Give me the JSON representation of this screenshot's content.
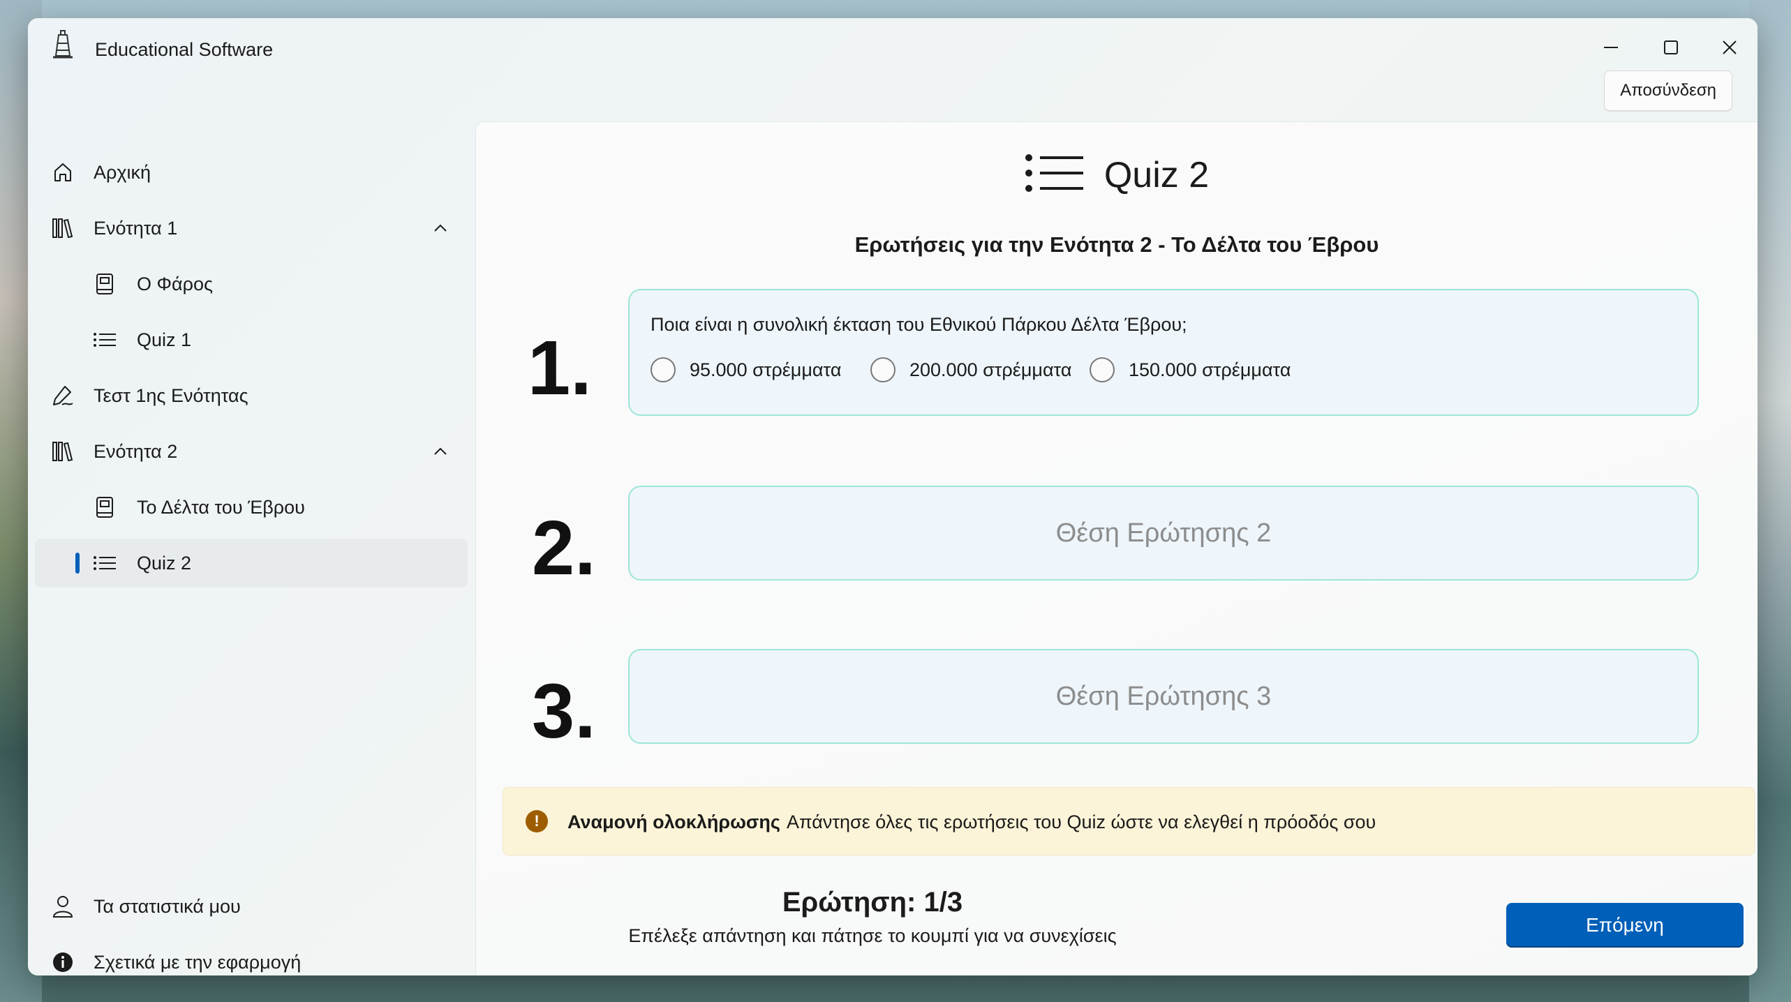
{
  "window": {
    "title": "Educational Software",
    "controls": [
      "minimize",
      "maximize",
      "close"
    ]
  },
  "header": {
    "logout_label": "Αποσύνδεση"
  },
  "sidebar": {
    "items": [
      {
        "label": "Αρχική",
        "icon": "home-icon"
      },
      {
        "label": "Ενότητα 1",
        "icon": "library-icon",
        "expanded": true
      },
      {
        "label": "Ο Φάρος",
        "icon": "book-icon"
      },
      {
        "label": "Quiz 1",
        "icon": "list-icon"
      },
      {
        "label": "Τεστ 1ης Ενότητας",
        "icon": "signature-icon"
      },
      {
        "label": "Ενότητα 2",
        "icon": "library-icon",
        "expanded": true
      },
      {
        "label": "Το Δέλτα του Έβρου",
        "icon": "book-icon"
      },
      {
        "label": "Quiz 2",
        "icon": "list-icon",
        "selected": true
      }
    ],
    "footer": [
      {
        "label": "Τα στατιστικά μου",
        "icon": "person-icon"
      },
      {
        "label": "Σχετικά με την εφαρμογή",
        "icon": "info-icon"
      }
    ]
  },
  "quiz": {
    "title": "Quiz 2",
    "subtitle": "Ερωτήσεις για την Ενότητα 2 - Το Δέλτα του Έβρου",
    "questions": [
      {
        "number": "1.",
        "text": "Ποια είναι η συνολική έκταση του Εθνικού Πάρκου Δέλτα Έβρου;",
        "options": [
          "95.000 στρέμματα",
          "200.000 στρέμματα",
          "150.000 στρέμματα"
        ]
      },
      {
        "number": "2.",
        "placeholder": "Θέση Ερώτησης 2"
      },
      {
        "number": "3.",
        "placeholder": "Θέση Ερώτησης 3"
      }
    ]
  },
  "info_bar": {
    "title": "Αναμονή ολοκλήρωσης",
    "message": "Απάντησε όλες τις ερωτήσεις του Quiz ώστε να ελεγθεί η πρόοδός σου",
    "color": "#9d5d00"
  },
  "progress": {
    "label": "Ερώτηση:  1/3",
    "hint": "Επέλεξε απάντηση και πάτησε το κουμπί για να συνεχίσεις"
  },
  "next_button": {
    "label": "Επόμενη",
    "color": "#005fb8"
  }
}
